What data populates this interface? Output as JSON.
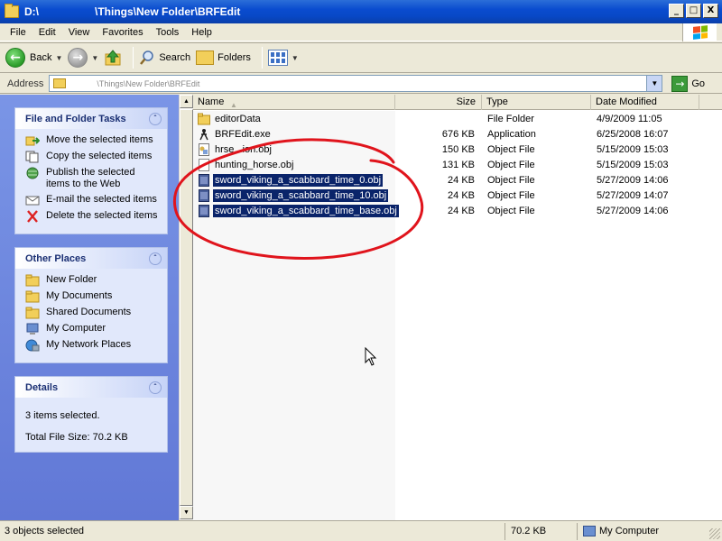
{
  "window": {
    "title_prefix": "D:\\",
    "title_suffix": "\\Things\\New Folder\\BRFEdit",
    "controls": {
      "minimize": "_",
      "maximize": "□",
      "close": "X"
    }
  },
  "menu": [
    "File",
    "Edit",
    "View",
    "Favorites",
    "Tools",
    "Help"
  ],
  "toolbar": {
    "back_label": "Back",
    "search_label": "Search",
    "folders_label": "Folders"
  },
  "address": {
    "label": "Address",
    "value": "\\Things\\New Folder\\BRFEdit",
    "go_label": "Go"
  },
  "sidebar": {
    "tasks": {
      "title": "File and Folder Tasks",
      "items": [
        {
          "label": "Move the selected items",
          "icon": "move-icon"
        },
        {
          "label": "Copy the selected items",
          "icon": "copy-icon"
        },
        {
          "label": "Publish the selected items to the Web",
          "icon": "publish-web-icon"
        },
        {
          "label": "E-mail the selected items",
          "icon": "email-icon"
        },
        {
          "label": "Delete the selected items",
          "icon": "delete-icon"
        }
      ]
    },
    "places": {
      "title": "Other Places",
      "items": [
        {
          "label": "New Folder",
          "icon": "folder-icon"
        },
        {
          "label": "My Documents",
          "icon": "folder-icon"
        },
        {
          "label": "Shared Documents",
          "icon": "folder-icon"
        },
        {
          "label": "My Computer",
          "icon": "computer-icon"
        },
        {
          "label": "My Network Places",
          "icon": "network-icon"
        }
      ]
    },
    "details": {
      "title": "Details",
      "selected_text": "3 items selected.",
      "total_text": "Total File Size: 70.2 KB"
    }
  },
  "filelist": {
    "columns": {
      "name": "Name",
      "size": "Size",
      "type": "Type",
      "date": "Date Modified"
    },
    "rows": [
      {
        "name": "editorData",
        "size": "",
        "type": "File Folder",
        "date": "4/9/2009 11:05",
        "icon": "folder-icon",
        "selected": false
      },
      {
        "name": "BRFEdit.exe",
        "size": "676 KB",
        "type": "Application",
        "date": "6/25/2008 16:07",
        "icon": "application-icon",
        "selected": false
      },
      {
        "name": "hrse...ion.obj",
        "size": "150 KB",
        "type": "Object File",
        "date": "5/15/2009 15:03",
        "icon": "object-file-icon",
        "selected": false
      },
      {
        "name": "hunting_horse.obj",
        "size": "131 KB",
        "type": "Object File",
        "date": "5/15/2009 15:03",
        "icon": "blank-file-icon",
        "selected": false
      },
      {
        "name": "sword_viking_a_scabbard_time_0.obj",
        "size": "24 KB",
        "type": "Object File",
        "date": "5/27/2009 14:06",
        "icon": "object-file-icon",
        "selected": true
      },
      {
        "name": "sword_viking_a_scabbard_time_10.obj",
        "size": "24 KB",
        "type": "Object File",
        "date": "5/27/2009 14:07",
        "icon": "object-file-icon",
        "selected": true
      },
      {
        "name": "sword_viking_a_scabbard_time_base.obj",
        "size": "24 KB",
        "type": "Object File",
        "date": "5/27/2009 14:06",
        "icon": "object-file-icon",
        "selected": true
      }
    ]
  },
  "status": {
    "objects": "3 objects selected",
    "size": "70.2 KB",
    "location": "My Computer"
  },
  "colors": {
    "selection": "#0a246a",
    "annotation": "#e0141c",
    "titlebar": "#0a4ccf"
  }
}
